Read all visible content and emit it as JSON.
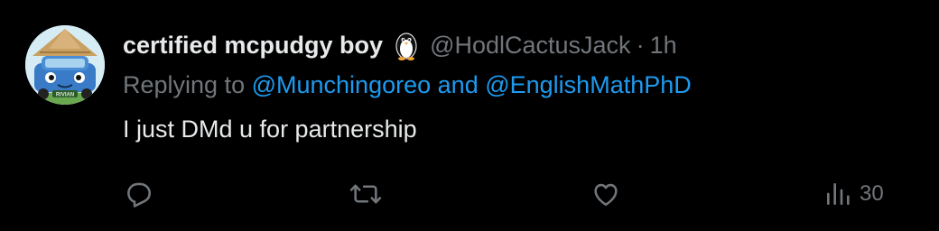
{
  "tweet": {
    "display_name": "certified mcpudgy boy",
    "handle": "@HodlCactusJack",
    "separator": "·",
    "time": "1h",
    "reply_prefix": "Replying to",
    "mention_1": "@Munchingoreo",
    "reply_and": "and",
    "mention_2": "@EnglishMathPhD",
    "text": "I just DMd u for partnership",
    "avatar_label": "RIVIAN"
  },
  "actions": {
    "views_count": "30"
  },
  "colors": {
    "background": "#000000",
    "primary_text": "#e7e9ea",
    "secondary_text": "#71767b",
    "link": "#1d9bf0"
  },
  "icons": [
    "penguin-badge-icon",
    "reply-icon",
    "retweet-icon",
    "like-icon",
    "views-icon"
  ]
}
